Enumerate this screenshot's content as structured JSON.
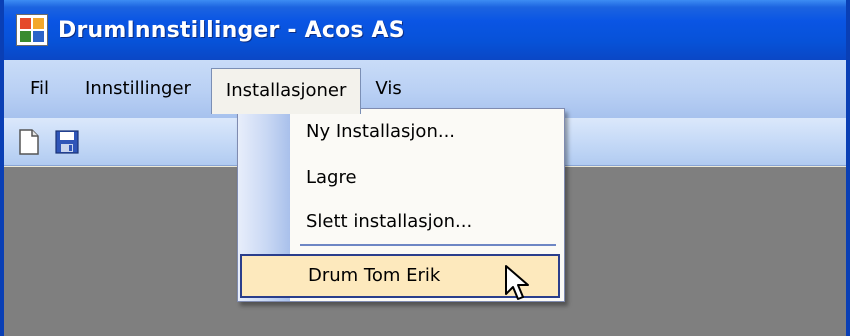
{
  "window": {
    "title": "DrumInnstillinger - Acos AS",
    "accent": "#0a55e4"
  },
  "menubar": {
    "items": [
      {
        "label": "Fil"
      },
      {
        "label": "Innstillinger"
      },
      {
        "label": "Installasjoner"
      },
      {
        "label": "Vis"
      }
    ]
  },
  "toolbar": {
    "buttons": [
      {
        "icon": "new-document-icon"
      },
      {
        "icon": "save-icon"
      }
    ]
  },
  "dropdown": {
    "items": [
      {
        "label": "Ny Installasjon..."
      },
      {
        "label": "Lagre"
      },
      {
        "label": "Slett installasjon..."
      }
    ],
    "highlighted_item": {
      "label": "Drum Tom Erik"
    },
    "highlight_color": "#fde9bd"
  }
}
